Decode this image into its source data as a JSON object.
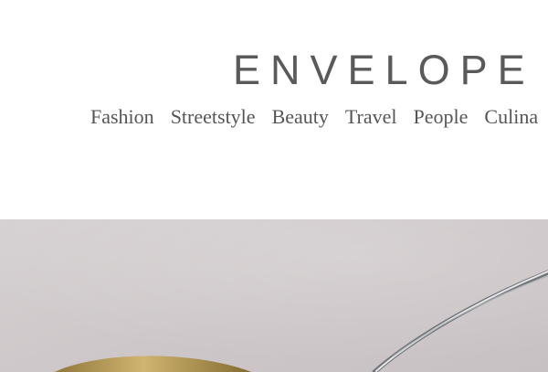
{
  "site": {
    "logo": "ENVELOPE"
  },
  "nav": {
    "items": [
      {
        "label": "Fashion"
      },
      {
        "label": "Streetstyle"
      },
      {
        "label": "Beauty"
      },
      {
        "label": "Travel"
      },
      {
        "label": "People"
      },
      {
        "label": "Culina"
      }
    ]
  },
  "hero": {
    "subject": "sunglasses photo",
    "colors": {
      "background": "#cfc9ca",
      "frame": "#b89a55",
      "temple": "#d9dbdc"
    }
  }
}
